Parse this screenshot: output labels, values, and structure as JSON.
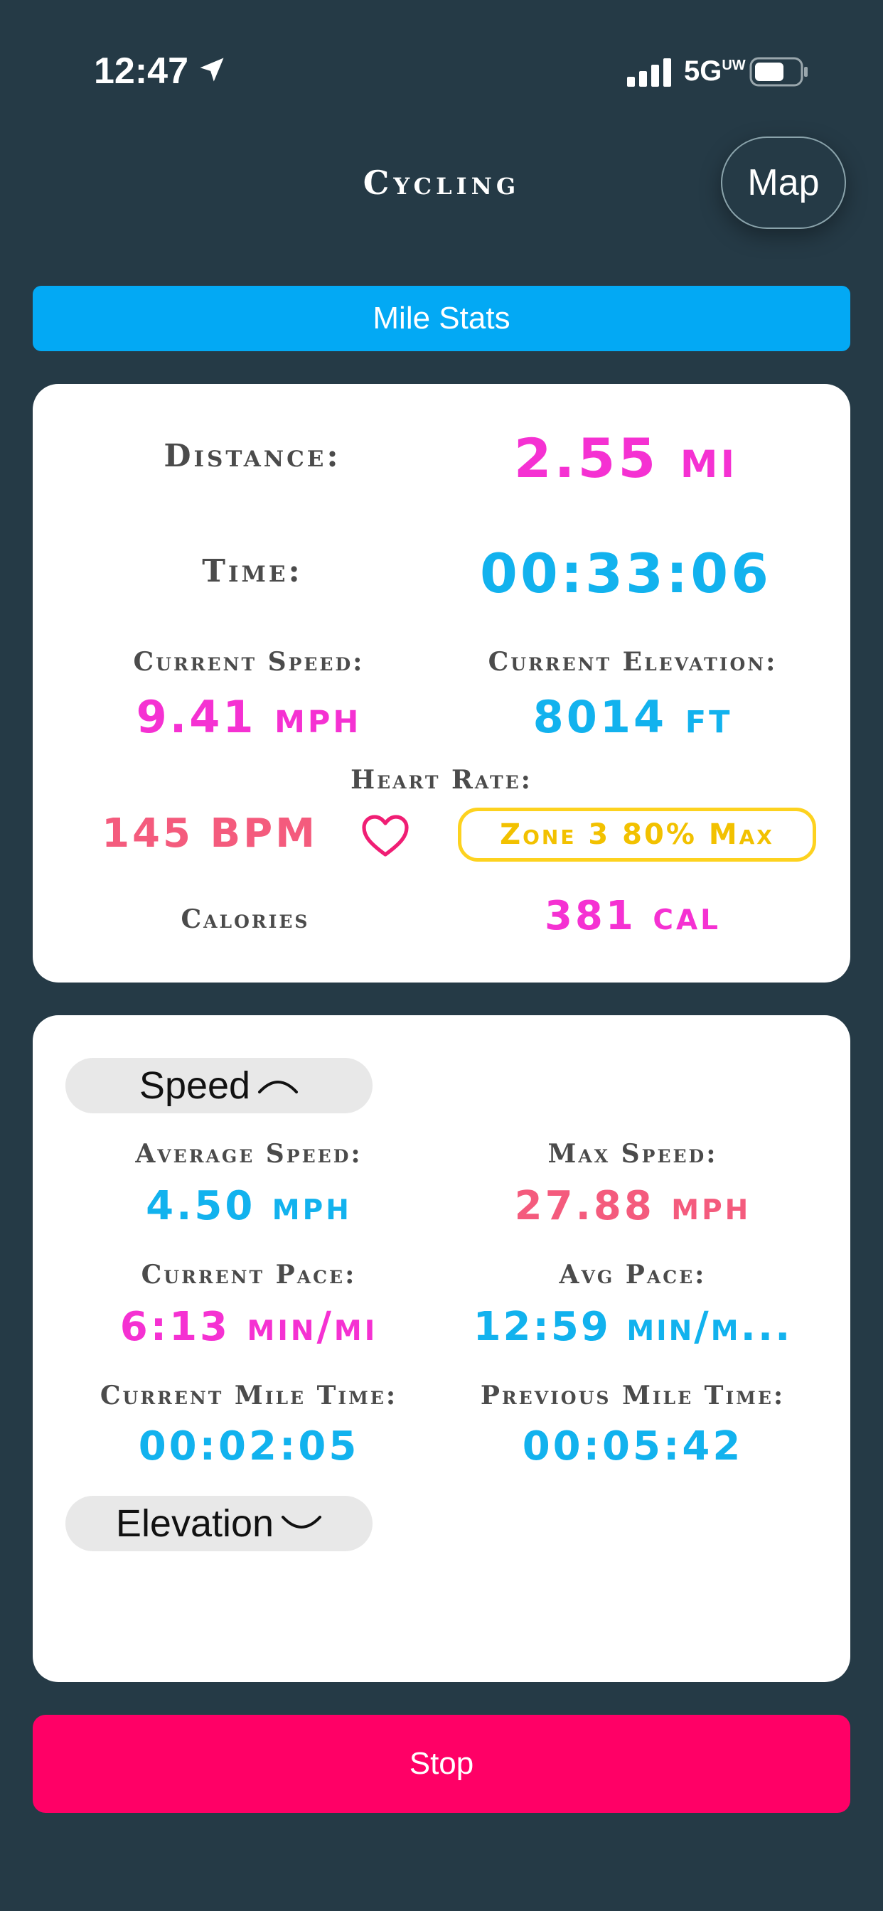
{
  "status": {
    "time": "12:47",
    "network": "5G",
    "network_sub": "UW"
  },
  "header": {
    "title": "Cycling",
    "map_label": "Map"
  },
  "tab": {
    "label": "Mile Stats"
  },
  "summary": {
    "distance_label": "Distance:",
    "distance_value": "2.55 mi",
    "time_label": "Time:",
    "time_value": "00:33:06",
    "current_speed_label": "Current Speed:",
    "current_speed_value": "9.41 mph",
    "current_elevation_label": "Current Elevation:",
    "current_elevation_value": "8014 ft",
    "heart_rate_label": "Heart Rate:",
    "heart_rate_value": "145 BPM",
    "zone_label": "Zone 3 80% Max",
    "calories_label": "Calories",
    "calories_value": "381 cal"
  },
  "speed_section": {
    "toggle_label": "Speed",
    "average_speed_label": "Average Speed:",
    "average_speed_value": "4.50 mph",
    "max_speed_label": "Max Speed:",
    "max_speed_value": "27.88 mph",
    "current_pace_label": "Current Pace:",
    "current_pace_value": "6:13 min/mi",
    "avg_pace_label": "Avg Pace:",
    "avg_pace_value": "12:59 min/m...",
    "current_mile_time_label": "Current Mile Time:",
    "current_mile_time_value": "00:02:05",
    "previous_mile_time_label": "Previous Mile Time:",
    "previous_mile_time_value": "00:05:42"
  },
  "elevation_section": {
    "toggle_label": "Elevation"
  },
  "footer": {
    "stop_label": "Stop"
  },
  "colors": {
    "background": "#253a46",
    "accent_blue": "#03a9f4",
    "stop_pink": "#ff0066",
    "value_pink": "#f531d2",
    "value_blue": "#12b2ee",
    "value_red": "#f45b7d",
    "zone_yellow": "#fdd21f"
  },
  "icons": [
    "location-arrow-icon",
    "signal-bars-icon",
    "battery-icon",
    "heart-icon",
    "chevron-up-icon",
    "chevron-down-icon"
  ]
}
